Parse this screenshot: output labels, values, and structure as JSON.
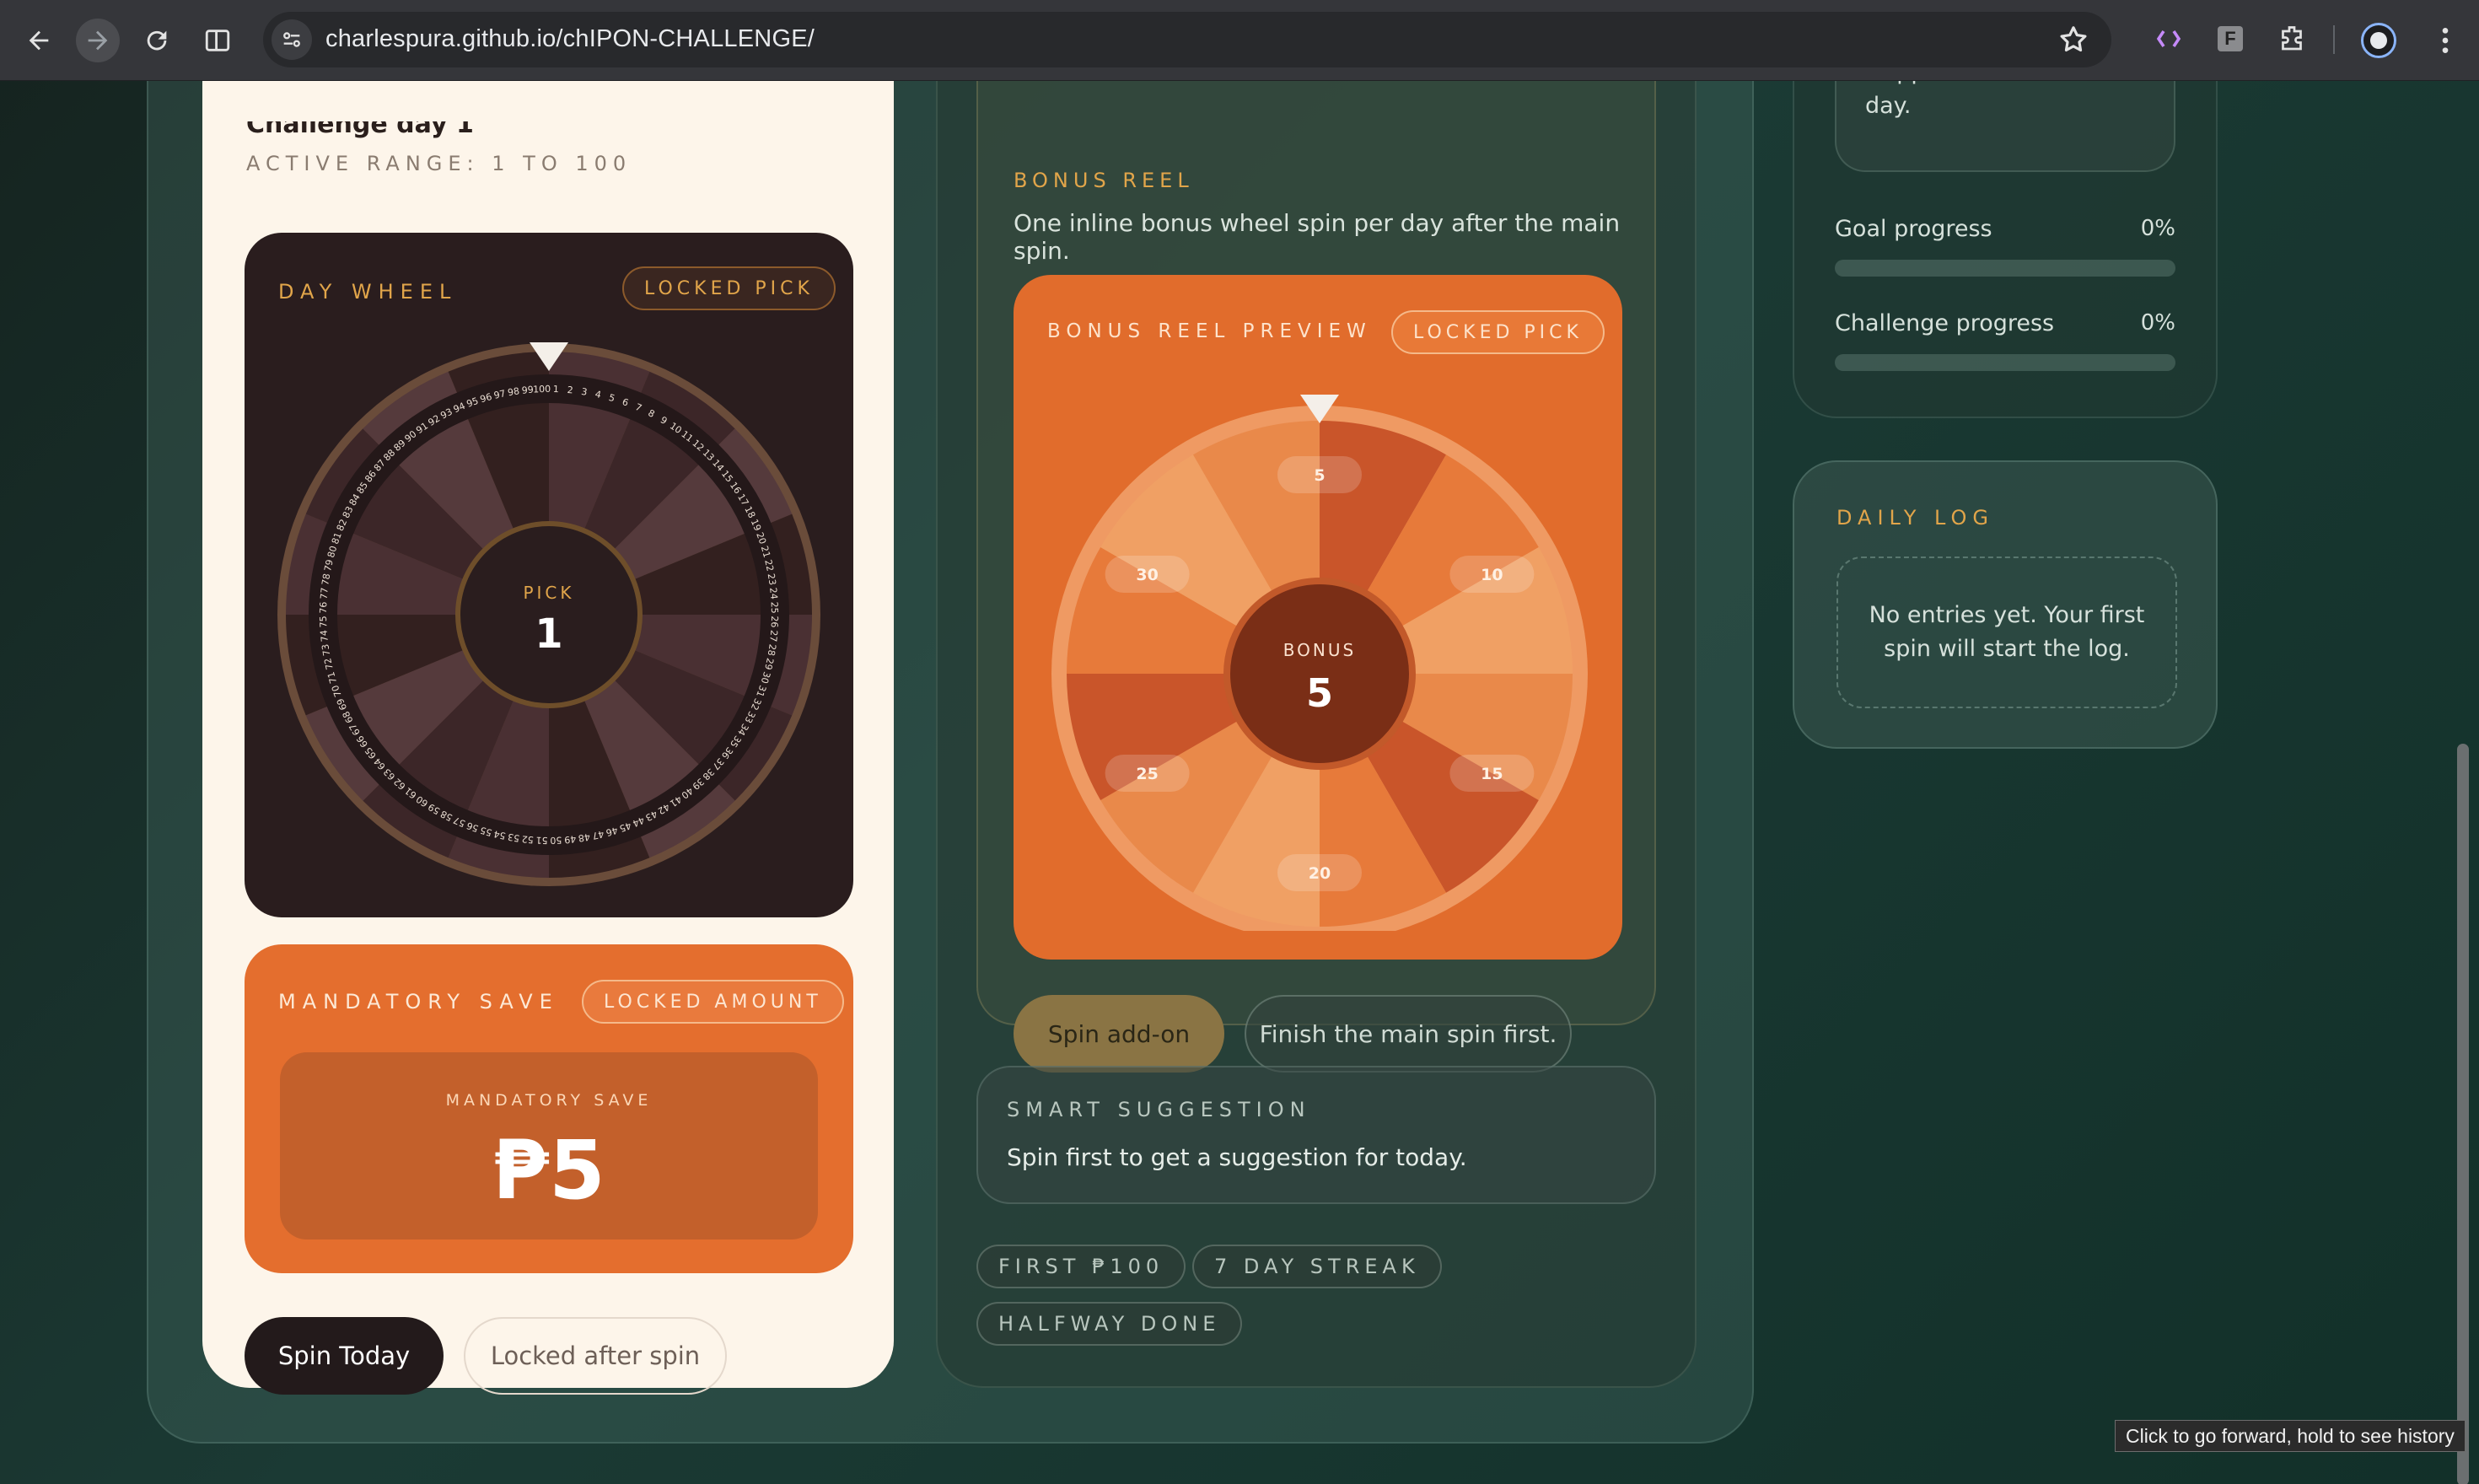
{
  "browser": {
    "url": "charlespura.github.io/chIPON-CHALLENGE/",
    "tooltip": "Click to go forward, hold to see history"
  },
  "left": {
    "day_label": "Challenge day 1",
    "active_range": "ACTIVE RANGE: 1 TO 100",
    "day_wheel": {
      "heading": "DAY WHEEL",
      "badge": "LOCKED PICK",
      "center_label": "PICK",
      "center_value": "1",
      "range_min": 1,
      "range_max": 100
    },
    "mandatory_save": {
      "heading": "MANDATORY SAVE",
      "badge": "LOCKED AMOUNT",
      "inner_label": "MANDATORY SAVE",
      "amount": "₱5"
    },
    "spin_button": "Spin Today",
    "locked_button": "Locked after spin"
  },
  "middle": {
    "bonus": {
      "heading": "BONUS REEL",
      "description": "One inline bonus wheel spin per day after the main spin.",
      "preview_heading": "BONUS REEL PREVIEW",
      "badge": "LOCKED PICK",
      "center_label": "BONUS",
      "center_value": "5",
      "segments": [
        "5",
        "10",
        "15",
        "20",
        "25",
        "30"
      ],
      "spin_addon": "Spin add-on",
      "hint": "Finish the main spin first."
    },
    "suggestion": {
      "heading": "SMART SUGGESTION",
      "text": "Spin first to get a suggestion for today."
    },
    "badges": [
      "FIRST ₱100",
      "7 DAY STREAK",
      "HALFWAY DONE"
    ]
  },
  "right": {
    "skipped_text": "skipped day.",
    "goal_progress_label": "Goal progress",
    "goal_progress_value": "0%",
    "goal_progress_fraction": 0,
    "challenge_progress_label": "Challenge progress",
    "challenge_progress_value": "0%",
    "challenge_progress_fraction": 0,
    "daily_log": {
      "heading": "DAILY LOG",
      "empty": "No entries yet. Your first spin will start the log."
    }
  },
  "colors": {
    "accent_gold": "#e1a54a",
    "orange": "#e46e2e",
    "dark_wheel": "#2a1d1e",
    "cream": "#fdf5ea"
  }
}
